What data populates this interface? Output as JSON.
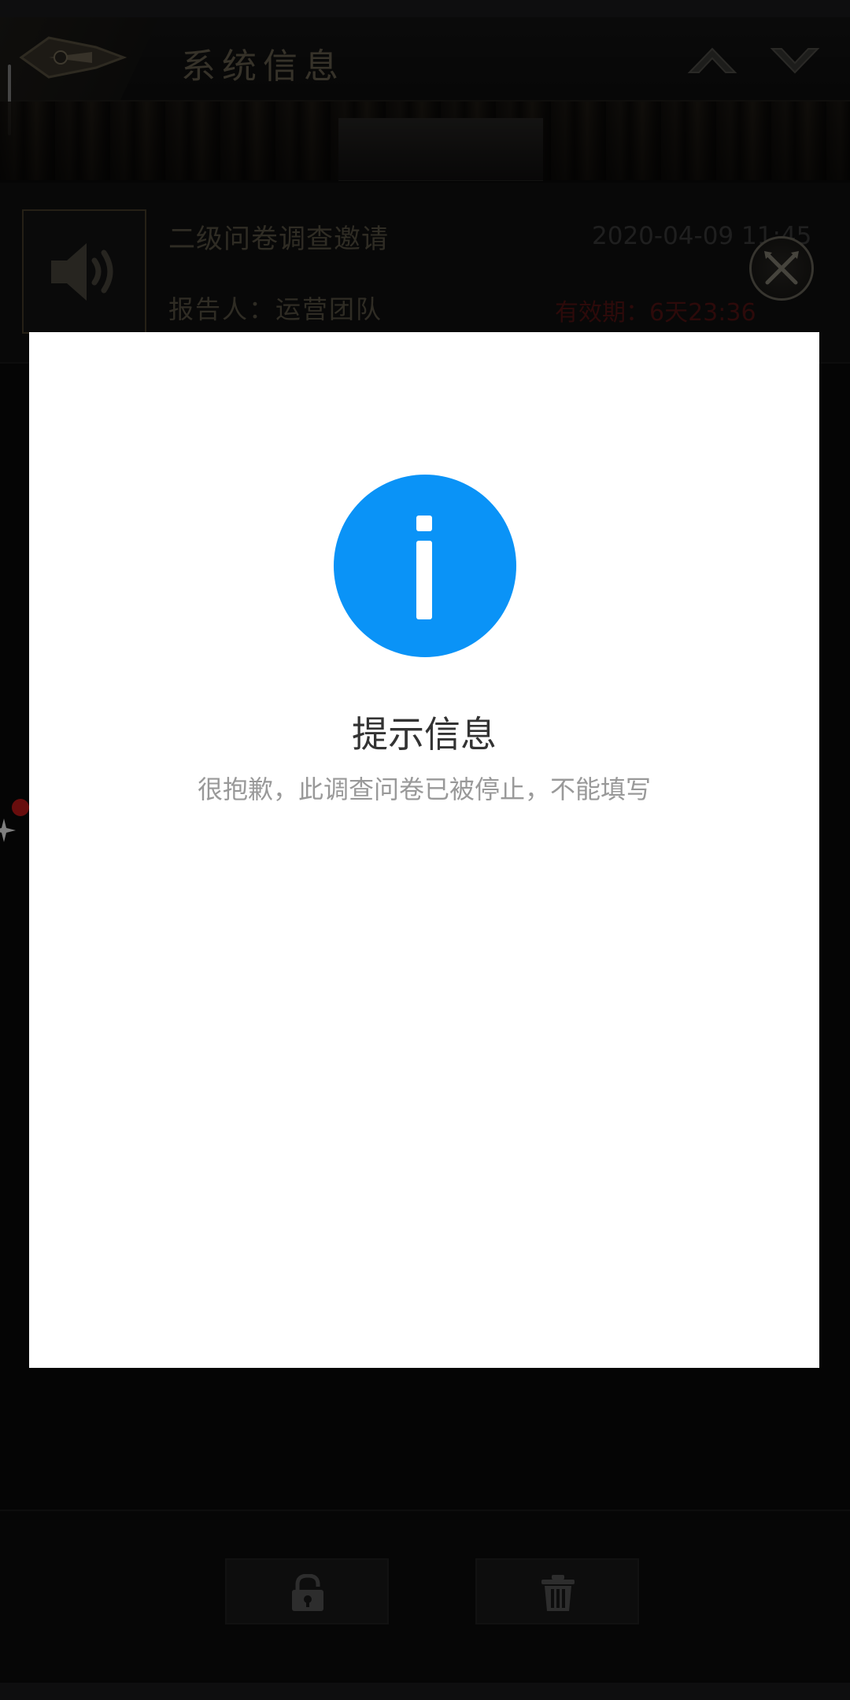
{
  "header": {
    "title": "系统信息",
    "back_icon": "arrowhead-emblem-icon",
    "up_icon": "chevron-up-icon",
    "down_icon": "chevron-down-icon"
  },
  "mail": {
    "icon": "speaker-icon",
    "subject": "二级问卷调查邀请",
    "date": "2020-04-09  11:45",
    "reporter": "报告人：运营团队",
    "expiry": "有效期：6天23:36"
  },
  "bottom_bar": {
    "lock_icon": "lock-icon",
    "delete_icon": "trash-icon"
  },
  "dialog": {
    "icon": "info-icon",
    "title": "提示信息",
    "message": "很抱歉，此调查问卷已被停止，不能填写"
  },
  "colors": {
    "info_blue": "#0a93f7",
    "expiry_red": "#5a1414",
    "gold_text": "#5e5848",
    "notification_red": "#d11a1a"
  }
}
